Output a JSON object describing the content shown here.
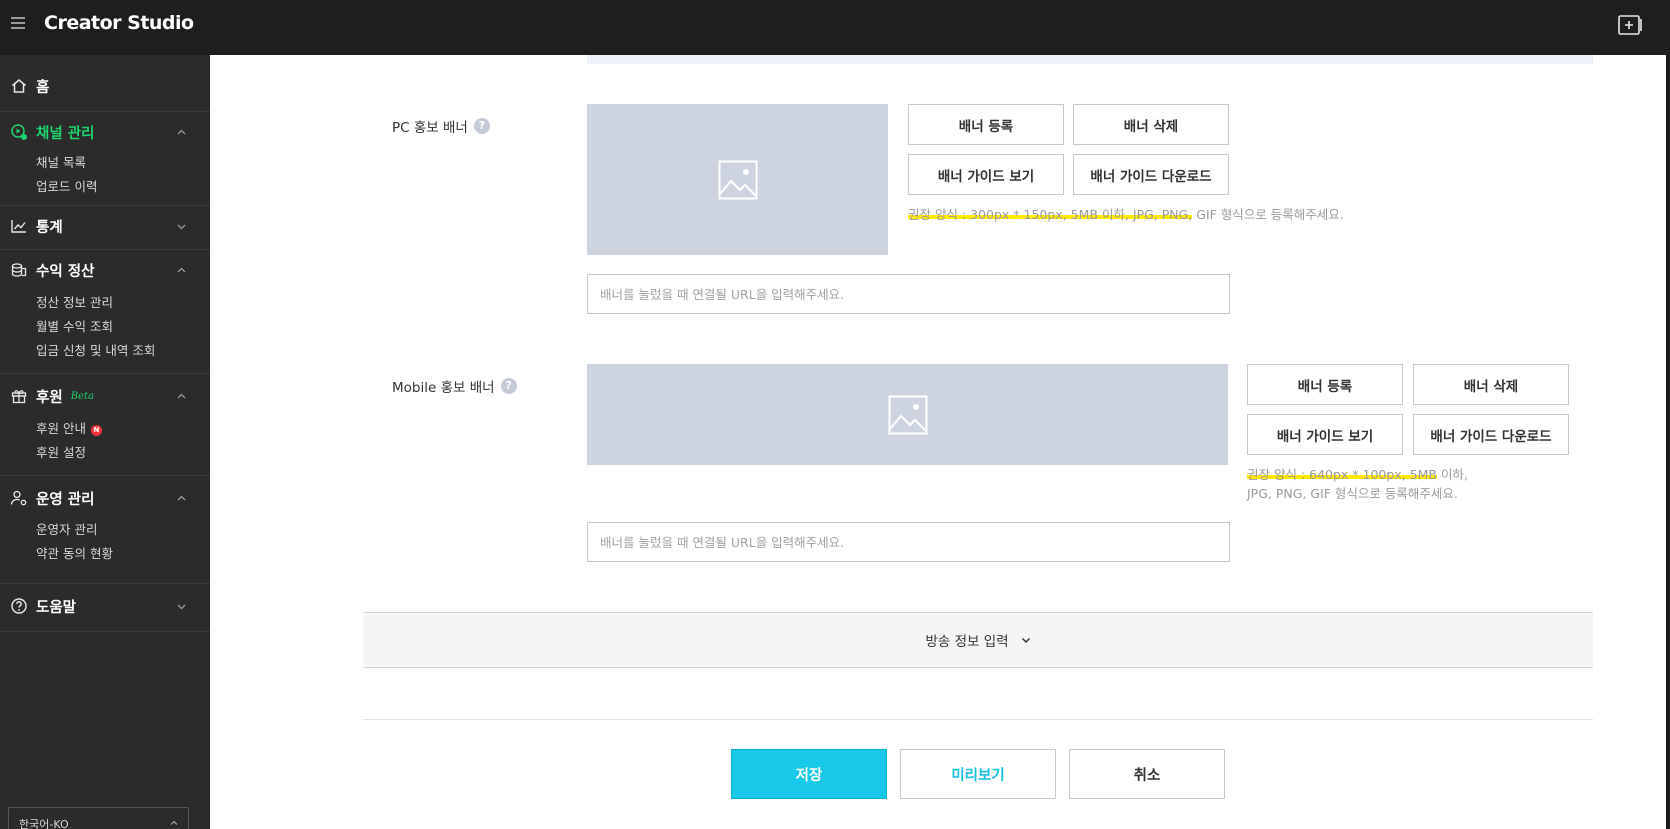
{
  "app": {
    "brand": "Creator Studio"
  },
  "colors": {
    "accent_green": "#1fd36e",
    "primary_cyan": "#17c8e8",
    "highlight_yellow": "#ffea00",
    "badge_red": "#f0353c"
  },
  "sidebar": {
    "home": {
      "label": "홈",
      "icon": "home-icon"
    },
    "channel": {
      "label": "채널 관리",
      "icon": "channel-settings-icon",
      "items": [
        "채널 목록",
        "업로드 이력"
      ]
    },
    "stats": {
      "label": "통계",
      "icon": "chart-line-icon"
    },
    "revenue": {
      "label": "수익 정산",
      "icon": "coins-icon",
      "items": [
        "정산 정보 관리",
        "월별 수익 조회",
        "입금 신청 및 내역 조회"
      ]
    },
    "support": {
      "label": "후원",
      "beta": "Beta",
      "icon": "gift-icon",
      "items": [
        "후원 안내",
        "후원 설정"
      ],
      "new_badge": "N"
    },
    "ops": {
      "label": "운영 관리",
      "icon": "user-gear-icon",
      "items": [
        "운영자 관리",
        "약관 동의 현황"
      ]
    },
    "help": {
      "label": "도움말",
      "icon": "question-circle-icon"
    },
    "language": "한국어-KO"
  },
  "pc_banner": {
    "label": "PC 홍보 배너",
    "help": "?",
    "buttons": {
      "register": "배너 등록",
      "delete": "배너 삭제",
      "guide_view": "배너 가이드 보기",
      "guide_download": "배너 가이드 다운로드"
    },
    "hint_highlighted": "권장 양식 : 300px * 150px, 5MB 이하, JPG, PNG,",
    "hint_rest": " GIF 형식으로 등록해주세요.",
    "url_placeholder": "배너를 눌렀을 때 연결될 URL을 입력해주세요."
  },
  "mobile_banner": {
    "label": "Mobile 홍보 배너",
    "help": "?",
    "buttons": {
      "register": "배너 등록",
      "delete": "배너 삭제",
      "guide_view": "배너 가이드 보기",
      "guide_download": "배너 가이드 다운로드"
    },
    "hint_highlighted": "권장 양식 : 640px * 100px, 5MB",
    "hint_rest": " 이하,",
    "hint_line2": "JPG, PNG, GIF 형식으로 등록해주세요.",
    "url_placeholder": "배너를 눌렀을 때 연결될 URL을 입력해주세요."
  },
  "broadcast_section": {
    "label": "방송 정보 입력"
  },
  "actions": {
    "save": "저장",
    "preview": "미리보기",
    "cancel": "취소"
  }
}
